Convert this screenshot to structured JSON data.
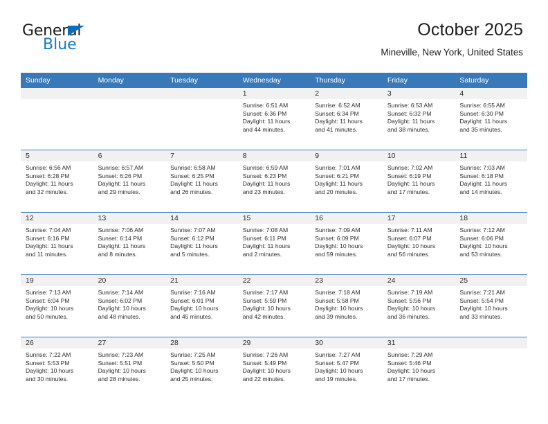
{
  "brand": {
    "name_top": "General",
    "name_bottom": "Blue",
    "triangle_color": "#0b6cb7",
    "text_color": "#127cc1"
  },
  "header": {
    "title": "October 2025",
    "subtitle": "Mineville, New York, United States"
  },
  "theme": {
    "header_blue": "#3a79b8",
    "daynum_band": "#f1f1f1",
    "cell_bg": "#ffffff",
    "text": "#2b2b2b"
  },
  "weekday_headers": [
    "Sunday",
    "Monday",
    "Tuesday",
    "Wednesday",
    "Thursday",
    "Friday",
    "Saturday"
  ],
  "weeks": [
    [
      {
        "empty": true
      },
      {
        "empty": true
      },
      {
        "empty": true
      },
      {
        "day": "1",
        "sunrise": "Sunrise: 6:51 AM",
        "sunset": "Sunset: 6:36 PM",
        "daylight1": "Daylight: 11 hours",
        "daylight2": "and 44 minutes."
      },
      {
        "day": "2",
        "sunrise": "Sunrise: 6:52 AM",
        "sunset": "Sunset: 6:34 PM",
        "daylight1": "Daylight: 11 hours",
        "daylight2": "and 41 minutes."
      },
      {
        "day": "3",
        "sunrise": "Sunrise: 6:53 AM",
        "sunset": "Sunset: 6:32 PM",
        "daylight1": "Daylight: 11 hours",
        "daylight2": "and 38 minutes."
      },
      {
        "day": "4",
        "sunrise": "Sunrise: 6:55 AM",
        "sunset": "Sunset: 6:30 PM",
        "daylight1": "Daylight: 11 hours",
        "daylight2": "and 35 minutes."
      }
    ],
    [
      {
        "day": "5",
        "sunrise": "Sunrise: 6:56 AM",
        "sunset": "Sunset: 6:28 PM",
        "daylight1": "Daylight: 11 hours",
        "daylight2": "and 32 minutes."
      },
      {
        "day": "6",
        "sunrise": "Sunrise: 6:57 AM",
        "sunset": "Sunset: 6:26 PM",
        "daylight1": "Daylight: 11 hours",
        "daylight2": "and 29 minutes."
      },
      {
        "day": "7",
        "sunrise": "Sunrise: 6:58 AM",
        "sunset": "Sunset: 6:25 PM",
        "daylight1": "Daylight: 11 hours",
        "daylight2": "and 26 minutes."
      },
      {
        "day": "8",
        "sunrise": "Sunrise: 6:59 AM",
        "sunset": "Sunset: 6:23 PM",
        "daylight1": "Daylight: 11 hours",
        "daylight2": "and 23 minutes."
      },
      {
        "day": "9",
        "sunrise": "Sunrise: 7:01 AM",
        "sunset": "Sunset: 6:21 PM",
        "daylight1": "Daylight: 11 hours",
        "daylight2": "and 20 minutes."
      },
      {
        "day": "10",
        "sunrise": "Sunrise: 7:02 AM",
        "sunset": "Sunset: 6:19 PM",
        "daylight1": "Daylight: 11 hours",
        "daylight2": "and 17 minutes."
      },
      {
        "day": "11",
        "sunrise": "Sunrise: 7:03 AM",
        "sunset": "Sunset: 6:18 PM",
        "daylight1": "Daylight: 11 hours",
        "daylight2": "and 14 minutes."
      }
    ],
    [
      {
        "day": "12",
        "sunrise": "Sunrise: 7:04 AM",
        "sunset": "Sunset: 6:16 PM",
        "daylight1": "Daylight: 11 hours",
        "daylight2": "and 11 minutes."
      },
      {
        "day": "13",
        "sunrise": "Sunrise: 7:06 AM",
        "sunset": "Sunset: 6:14 PM",
        "daylight1": "Daylight: 11 hours",
        "daylight2": "and 8 minutes."
      },
      {
        "day": "14",
        "sunrise": "Sunrise: 7:07 AM",
        "sunset": "Sunset: 6:12 PM",
        "daylight1": "Daylight: 11 hours",
        "daylight2": "and 5 minutes."
      },
      {
        "day": "15",
        "sunrise": "Sunrise: 7:08 AM",
        "sunset": "Sunset: 6:11 PM",
        "daylight1": "Daylight: 11 hours",
        "daylight2": "and 2 minutes."
      },
      {
        "day": "16",
        "sunrise": "Sunrise: 7:09 AM",
        "sunset": "Sunset: 6:09 PM",
        "daylight1": "Daylight: 10 hours",
        "daylight2": "and 59 minutes."
      },
      {
        "day": "17",
        "sunrise": "Sunrise: 7:11 AM",
        "sunset": "Sunset: 6:07 PM",
        "daylight1": "Daylight: 10 hours",
        "daylight2": "and 56 minutes."
      },
      {
        "day": "18",
        "sunrise": "Sunrise: 7:12 AM",
        "sunset": "Sunset: 6:06 PM",
        "daylight1": "Daylight: 10 hours",
        "daylight2": "and 53 minutes."
      }
    ],
    [
      {
        "day": "19",
        "sunrise": "Sunrise: 7:13 AM",
        "sunset": "Sunset: 6:04 PM",
        "daylight1": "Daylight: 10 hours",
        "daylight2": "and 50 minutes."
      },
      {
        "day": "20",
        "sunrise": "Sunrise: 7:14 AM",
        "sunset": "Sunset: 6:02 PM",
        "daylight1": "Daylight: 10 hours",
        "daylight2": "and 48 minutes."
      },
      {
        "day": "21",
        "sunrise": "Sunrise: 7:16 AM",
        "sunset": "Sunset: 6:01 PM",
        "daylight1": "Daylight: 10 hours",
        "daylight2": "and 45 minutes."
      },
      {
        "day": "22",
        "sunrise": "Sunrise: 7:17 AM",
        "sunset": "Sunset: 5:59 PM",
        "daylight1": "Daylight: 10 hours",
        "daylight2": "and 42 minutes."
      },
      {
        "day": "23",
        "sunrise": "Sunrise: 7:18 AM",
        "sunset": "Sunset: 5:58 PM",
        "daylight1": "Daylight: 10 hours",
        "daylight2": "and 39 minutes."
      },
      {
        "day": "24",
        "sunrise": "Sunrise: 7:19 AM",
        "sunset": "Sunset: 5:56 PM",
        "daylight1": "Daylight: 10 hours",
        "daylight2": "and 36 minutes."
      },
      {
        "day": "25",
        "sunrise": "Sunrise: 7:21 AM",
        "sunset": "Sunset: 5:54 PM",
        "daylight1": "Daylight: 10 hours",
        "daylight2": "and 33 minutes."
      }
    ],
    [
      {
        "day": "26",
        "sunrise": "Sunrise: 7:22 AM",
        "sunset": "Sunset: 5:53 PM",
        "daylight1": "Daylight: 10 hours",
        "daylight2": "and 30 minutes."
      },
      {
        "day": "27",
        "sunrise": "Sunrise: 7:23 AM",
        "sunset": "Sunset: 5:51 PM",
        "daylight1": "Daylight: 10 hours",
        "daylight2": "and 28 minutes."
      },
      {
        "day": "28",
        "sunrise": "Sunrise: 7:25 AM",
        "sunset": "Sunset: 5:50 PM",
        "daylight1": "Daylight: 10 hours",
        "daylight2": "and 25 minutes."
      },
      {
        "day": "29",
        "sunrise": "Sunrise: 7:26 AM",
        "sunset": "Sunset: 5:49 PM",
        "daylight1": "Daylight: 10 hours",
        "daylight2": "and 22 minutes."
      },
      {
        "day": "30",
        "sunrise": "Sunrise: 7:27 AM",
        "sunset": "Sunset: 5:47 PM",
        "daylight1": "Daylight: 10 hours",
        "daylight2": "and 19 minutes."
      },
      {
        "day": "31",
        "sunrise": "Sunrise: 7:29 AM",
        "sunset": "Sunset: 5:46 PM",
        "daylight1": "Daylight: 10 hours",
        "daylight2": "and 17 minutes."
      },
      {
        "empty": true
      }
    ]
  ]
}
